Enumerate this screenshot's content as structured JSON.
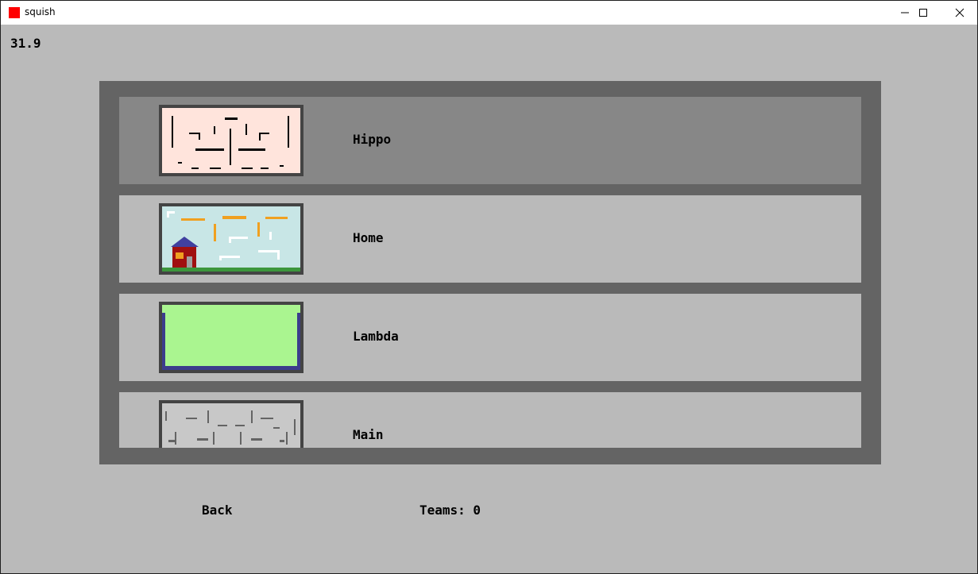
{
  "window": {
    "title": "squish",
    "icon": "red-square-app-icon",
    "controls": [
      "minimize-icon",
      "maximize-icon",
      "close-icon"
    ]
  },
  "hud": {
    "fps": "31.9"
  },
  "maps": [
    {
      "name": "Hippo",
      "thumbnail": "hippo-map-thumbnail",
      "thumb_bg": "#ffe4dc",
      "selected": true
    },
    {
      "name": "Home",
      "thumbnail": "home-map-thumbnail",
      "thumb_bg": "#c8e6e6",
      "selected": false
    },
    {
      "name": "Lambda",
      "thumbnail": "lambda-map-thumbnail",
      "thumb_bg": "#aaf590",
      "selected": false
    },
    {
      "name": "Main",
      "thumbnail": "main-map-thumbnail",
      "thumb_bg": "#c8c8c8",
      "selected": false
    }
  ],
  "footer": {
    "back_label": "Back",
    "teams_label": "Teams: 0"
  },
  "colors": {
    "background": "#bababa",
    "panel": "#646464",
    "row": "#bababa",
    "row_selected": "#878787",
    "thumb_border": "#444444"
  }
}
